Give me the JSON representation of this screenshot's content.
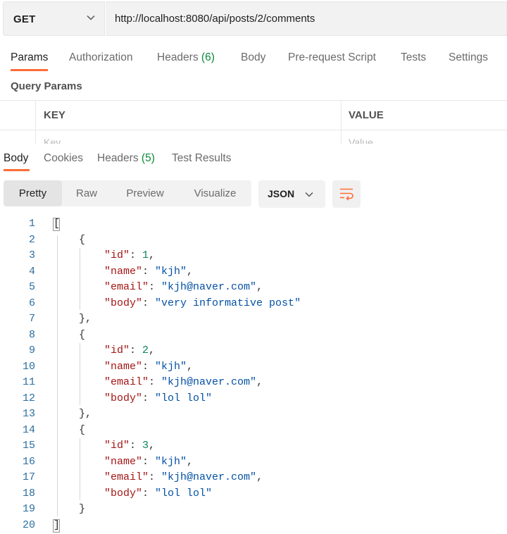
{
  "request": {
    "method": "GET",
    "url": "http://localhost:8080/api/posts/2/comments"
  },
  "request_tabs": {
    "params": "Params",
    "authorization": "Authorization",
    "headers": "Headers",
    "headers_count": "(6)",
    "body": "Body",
    "prerequest": "Pre-request Script",
    "tests": "Tests",
    "settings": "Settings"
  },
  "query_params": {
    "title": "Query Params",
    "key_header": "KEY",
    "value_header": "VALUE",
    "key_placeholder": "Key",
    "value_placeholder": "Value"
  },
  "response_tabs": {
    "body": "Body",
    "cookies": "Cookies",
    "headers": "Headers",
    "headers_count": "(5)",
    "test_results": "Test Results"
  },
  "view_modes": [
    "Pretty",
    "Raw",
    "Preview",
    "Visualize"
  ],
  "format": "JSON",
  "accent_color": "#ff6c37",
  "icons": {
    "method_dropdown": "chevron-down-icon",
    "format_dropdown": "chevron-down-icon",
    "wrap": "wrap-lines-icon"
  },
  "response_lines": [
    {
      "n": "1",
      "text": "["
    },
    {
      "n": "2",
      "text": "{"
    },
    {
      "n": "3",
      "key": "\"id\"",
      "val": "1",
      "type": "num",
      "comma": ","
    },
    {
      "n": "4",
      "key": "\"name\"",
      "val": "\"kjh\"",
      "type": "str",
      "comma": ","
    },
    {
      "n": "5",
      "key": "\"email\"",
      "val": "\"kjh@naver.com\"",
      "type": "str",
      "comma": ","
    },
    {
      "n": "6",
      "key": "\"body\"",
      "val": "\"very informative post\"",
      "type": "str",
      "comma": ""
    },
    {
      "n": "7",
      "text": "},"
    },
    {
      "n": "8",
      "text": "{"
    },
    {
      "n": "9",
      "key": "\"id\"",
      "val": "2",
      "type": "num",
      "comma": ","
    },
    {
      "n": "10",
      "key": "\"name\"",
      "val": "\"kjh\"",
      "type": "str",
      "comma": ","
    },
    {
      "n": "11",
      "key": "\"email\"",
      "val": "\"kjh@naver.com\"",
      "type": "str",
      "comma": ","
    },
    {
      "n": "12",
      "key": "\"body\"",
      "val": "\"lol lol\"",
      "type": "str",
      "comma": ""
    },
    {
      "n": "13",
      "text": "},"
    },
    {
      "n": "14",
      "text": "{"
    },
    {
      "n": "15",
      "key": "\"id\"",
      "val": "3",
      "type": "num",
      "comma": ","
    },
    {
      "n": "16",
      "key": "\"name\"",
      "val": "\"kjh\"",
      "type": "str",
      "comma": ","
    },
    {
      "n": "17",
      "key": "\"email\"",
      "val": "\"kjh@naver.com\"",
      "type": "str",
      "comma": ","
    },
    {
      "n": "18",
      "key": "\"body\"",
      "val": "\"lol lol\"",
      "type": "str",
      "comma": ""
    },
    {
      "n": "19",
      "text": "}"
    },
    {
      "n": "20",
      "text": "]"
    }
  ]
}
